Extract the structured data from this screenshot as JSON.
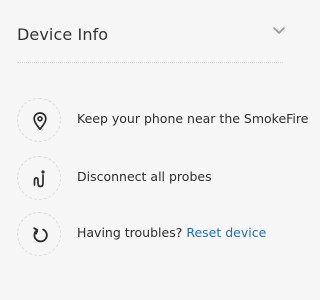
{
  "header": {
    "title": "Device Info",
    "collapse_icon": "chevron-down-icon"
  },
  "instructions": [
    {
      "icon": "location-pin-icon",
      "text": "Keep your phone near the SmokeFire"
    },
    {
      "icon": "probe-icon",
      "text": "Disconnect all probes"
    },
    {
      "icon": "reset-icon",
      "text": "Having troubles?",
      "link": "Reset device"
    }
  ],
  "colors": {
    "background": "#f6f6f6",
    "link": "#1e6fbf",
    "text": "#2e2e2e"
  }
}
